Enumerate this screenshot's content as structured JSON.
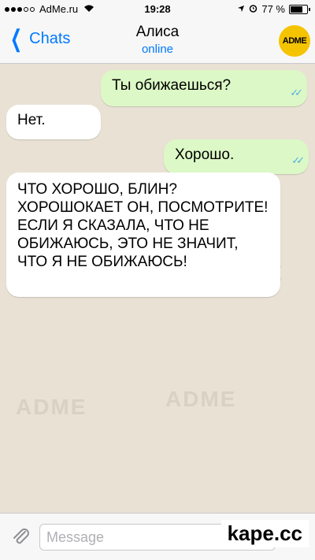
{
  "status": {
    "carrier": "AdMe.ru",
    "time": "19:28",
    "battery": "77 %"
  },
  "header": {
    "back_label": "Chats",
    "contact_name": "Алиса",
    "contact_status": "online",
    "avatar_text": "ADME"
  },
  "messages": [
    {
      "direction": "out",
      "text": "Ты обижаешься?"
    },
    {
      "direction": "in",
      "text": "Нет."
    },
    {
      "direction": "out",
      "text": "Хорошо."
    },
    {
      "direction": "in",
      "text": "ЧТО ХОРОШО, БЛИН? ХОРОШОКАЕТ ОН, ПОСМОТРИТЕ! ЕСЛИ Я СКАЗАЛА, ЧТО НЕ ОБИЖАЮСЬ, ЭТО НЕ ЗНАЧИТ, ЧТО Я НЕ ОБИЖАЮСЬ!"
    }
  ],
  "watermark": "ADME",
  "input": {
    "placeholder": "Message"
  },
  "credit": "kape.cc"
}
